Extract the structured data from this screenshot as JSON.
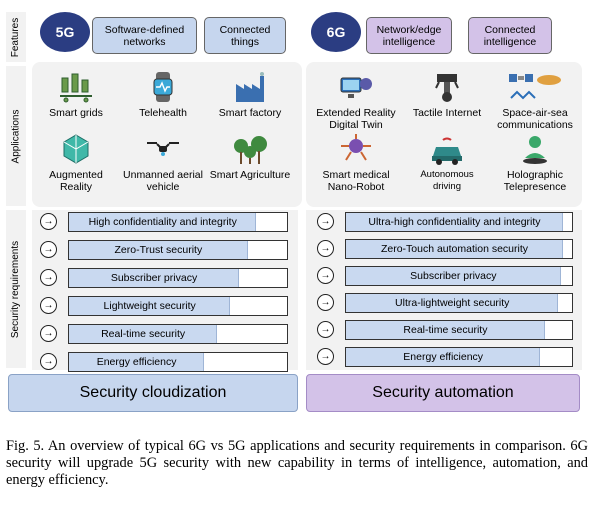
{
  "side_labels": {
    "features": "Features",
    "applications": "Applications",
    "security": "Security requirements"
  },
  "g5": {
    "badge": "5G",
    "features": [
      "Software-defined networks",
      "Connected things"
    ],
    "apps": [
      {
        "label": "Smart grids",
        "icon": "smart-grids-icon"
      },
      {
        "label": "Telehealth",
        "icon": "telehealth-icon"
      },
      {
        "label": "Smart factory",
        "icon": "factory-icon"
      },
      {
        "label": "Augmented Reality",
        "icon": "augmented-reality-icon"
      },
      {
        "label": "Unmanned aerial vehicle",
        "icon": "drone-icon"
      },
      {
        "label": "Smart Agriculture",
        "icon": "agriculture-icon"
      }
    ],
    "requirements": [
      {
        "label": "High confidentiality and integrity",
        "level": 0.86
      },
      {
        "label": "Zero-Trust security",
        "level": 0.82
      },
      {
        "label": "Subscriber privacy",
        "level": 0.78
      },
      {
        "label": "Lightweight security",
        "level": 0.74
      },
      {
        "label": "Real-time security",
        "level": 0.68
      },
      {
        "label": "Energy efficiency",
        "level": 0.62
      }
    ],
    "bottom": "Security cloudization"
  },
  "g6": {
    "badge": "6G",
    "features": [
      "Network/edge intelligence",
      "Connected intelligence"
    ],
    "apps": [
      {
        "label": "Extended Reality Digital Twin",
        "icon": "vr-headset-icon"
      },
      {
        "label": "Tactile Internet",
        "icon": "robot-arm-icon"
      },
      {
        "label": "Space-air-sea communications",
        "icon": "satellite-icon"
      },
      {
        "label": "Smart medical Nano-Robot",
        "icon": "nano-robot-icon"
      },
      {
        "label": "Autonomous driving",
        "icon": "autonomous-car-icon"
      },
      {
        "label": "Holographic Telepresence",
        "icon": "hologram-icon"
      }
    ],
    "requirements": [
      {
        "label": "Ultra-high confidentiality and integrity",
        "level": 0.96
      },
      {
        "label": "Zero-Touch automation security",
        "level": 0.96
      },
      {
        "label": "Subscriber privacy",
        "level": 0.95
      },
      {
        "label": "Ultra-lightweight security",
        "level": 0.94
      },
      {
        "label": "Real-time security",
        "level": 0.88
      },
      {
        "label": "Energy efficiency",
        "level": 0.86
      }
    ],
    "bottom": "Security automation"
  },
  "colors": {
    "badge": "#2b3d82",
    "feature_5g": "#c6d6ee",
    "feature_6g": "#d3c2e8",
    "req_fill": "#c9d9f0",
    "bottom_5g": "#c6d6ee",
    "bottom_6g": "#d3c2e8",
    "panel": "#f2f2f2"
  },
  "caption": "Fig. 5.    An overview of typical 6G vs 5G applications and security requirements in comparison. 6G security will upgrade 5G security with new capability in terms of intelligence, automation, and energy efficiency."
}
